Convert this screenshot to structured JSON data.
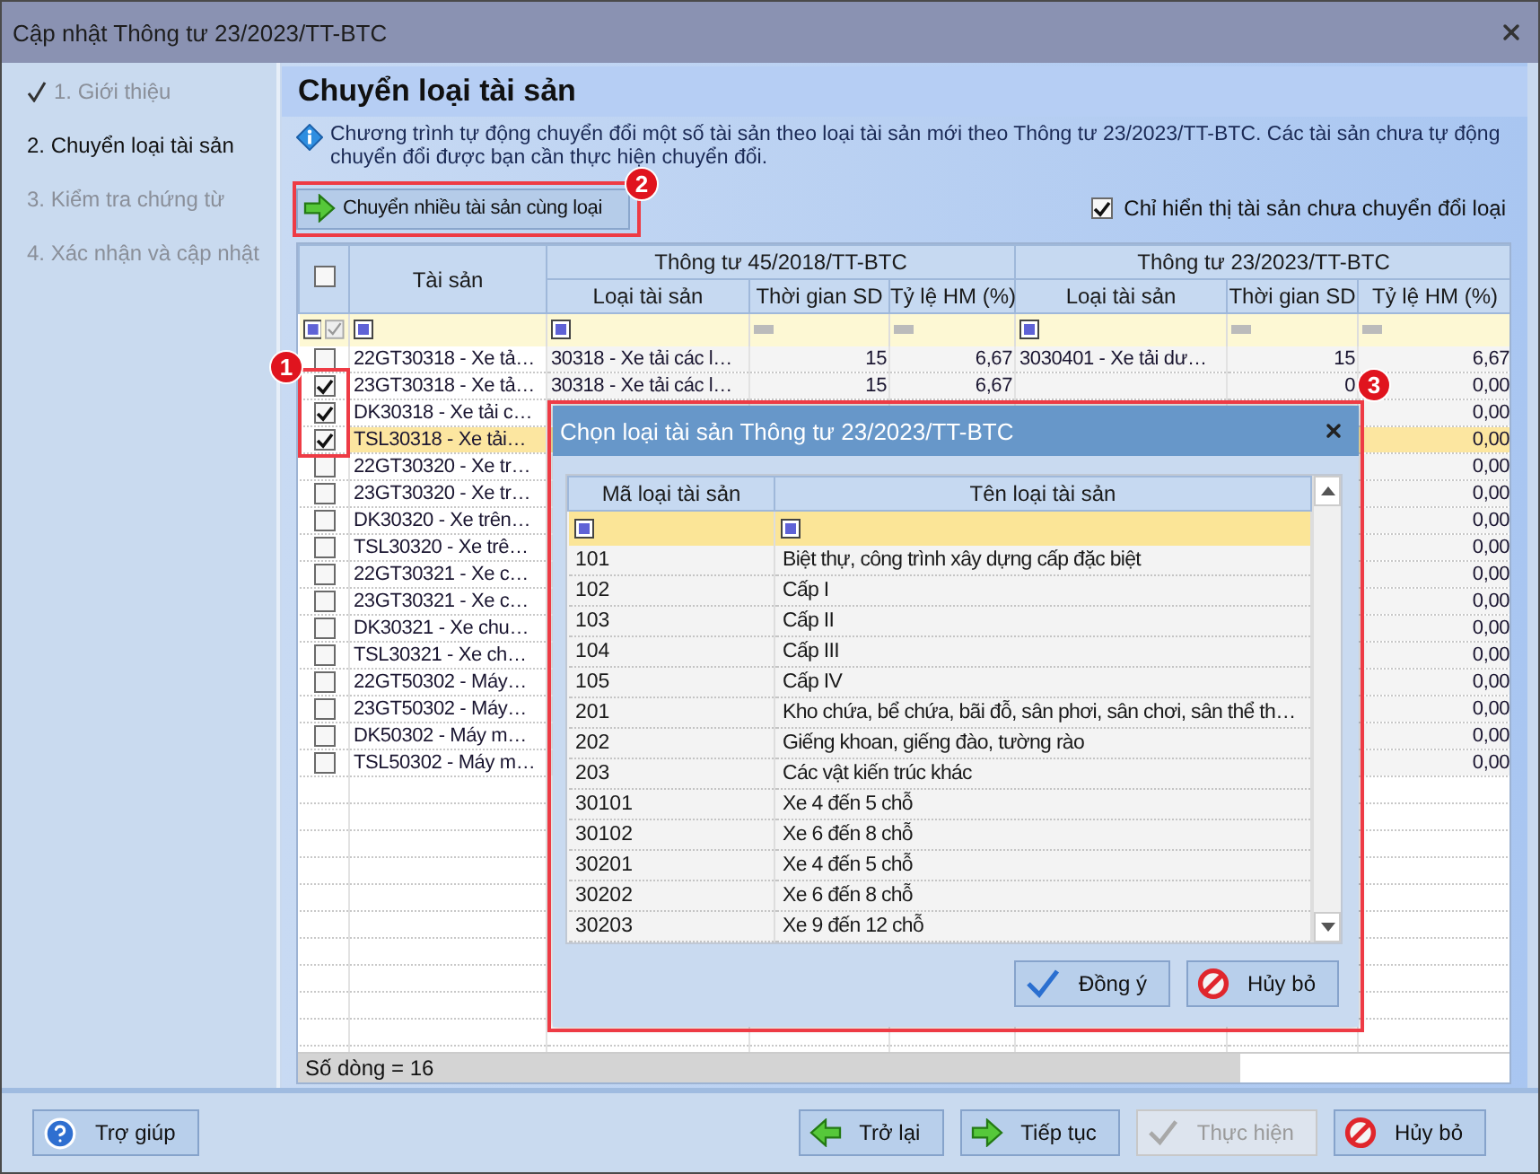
{
  "window": {
    "title": "Cập nhật Thông tư 23/2023/TT-BTC"
  },
  "steps": [
    {
      "label": "1. Giới thiệu",
      "done": true,
      "selected": false
    },
    {
      "label": "2. Chuyển loại tài sản",
      "done": false,
      "selected": true
    },
    {
      "label": "3. Kiểm tra chứng từ",
      "done": false,
      "selected": false
    },
    {
      "label": "4. Xác nhận và cập nhật",
      "done": false,
      "selected": false
    }
  ],
  "page": {
    "heading": "Chuyển loại tài sản",
    "info": "Chương trình tự động chuyển đổi một số tài sản theo loại tài sản mới theo Thông tư 23/2023/TT-BTC. Các tài sản chưa tự động chuyển đổi được bạn cần thực hiện chuyển đổi."
  },
  "convert_button": {
    "label": "Chuyển nhiều tài sản cùng loại"
  },
  "filter_toggle": {
    "label": "Chỉ hiển thị tài sản chưa chuyển đổi loại",
    "checked": true
  },
  "table": {
    "select_all": {
      "checked": false
    },
    "asset_column": {
      "label": "Tài sản"
    },
    "groups": [
      {
        "label": "Thông tư 45/2018/TT-BTC",
        "columns": [
          {
            "label": "Loại tài sản",
            "kind": "text"
          },
          {
            "label": "Thời gian SD",
            "kind": "number"
          },
          {
            "label": "Tỷ lệ HM (%)",
            "kind": "number"
          }
        ]
      },
      {
        "label": "Thông tư 23/2023/TT-BTC",
        "columns": [
          {
            "label": "Loại tài sản",
            "kind": "text"
          },
          {
            "label": "Thời gian SD",
            "kind": "number"
          },
          {
            "label": "Tỷ lệ HM (%)",
            "kind": "number"
          }
        ]
      }
    ],
    "rows": [
      {
        "checked": false,
        "selected": false,
        "cells": [
          "22GT30318 - Xe tả…",
          "30318 - Xe tải các l…",
          "15",
          "6,67",
          "3030401 - Xe tải dư…",
          "15",
          "6,67"
        ]
      },
      {
        "checked": true,
        "selected": false,
        "cells": [
          "23GT30318 - Xe tả…",
          "30318 - Xe tải các l…",
          "15",
          "6,67",
          null,
          "0",
          "0,00"
        ]
      },
      {
        "checked": true,
        "selected": false,
        "cells": [
          "DK30318 - Xe tải c…",
          null,
          null,
          null,
          null,
          null,
          "0,00"
        ]
      },
      {
        "checked": true,
        "selected": true,
        "cells": [
          "TSL30318 - Xe tải…",
          null,
          null,
          null,
          null,
          null,
          "0,00"
        ]
      },
      {
        "checked": false,
        "selected": false,
        "cells": [
          "22GT30320 - Xe tr…",
          null,
          null,
          null,
          null,
          null,
          "0,00"
        ]
      },
      {
        "checked": false,
        "selected": false,
        "cells": [
          "23GT30320 - Xe tr…",
          null,
          null,
          null,
          null,
          null,
          "0,00"
        ]
      },
      {
        "checked": false,
        "selected": false,
        "cells": [
          "DK30320 - Xe trên…",
          null,
          null,
          null,
          null,
          null,
          "0,00"
        ]
      },
      {
        "checked": false,
        "selected": false,
        "cells": [
          "TSL30320 - Xe trê…",
          null,
          null,
          null,
          null,
          null,
          "0,00"
        ]
      },
      {
        "checked": false,
        "selected": false,
        "cells": [
          "22GT30321 - Xe c…",
          null,
          null,
          null,
          null,
          null,
          "0,00"
        ]
      },
      {
        "checked": false,
        "selected": false,
        "cells": [
          "23GT30321 - Xe c…",
          null,
          null,
          null,
          null,
          null,
          "0,00"
        ]
      },
      {
        "checked": false,
        "selected": false,
        "cells": [
          "DK30321 - Xe chu…",
          null,
          null,
          null,
          null,
          null,
          "0,00"
        ]
      },
      {
        "checked": false,
        "selected": false,
        "cells": [
          "TSL30321 - Xe ch…",
          null,
          null,
          null,
          null,
          null,
          "0,00"
        ]
      },
      {
        "checked": false,
        "selected": false,
        "cells": [
          "22GT50302 - Máy…",
          null,
          null,
          null,
          null,
          null,
          "0,00"
        ]
      },
      {
        "checked": false,
        "selected": false,
        "cells": [
          "23GT50302 - Máy…",
          null,
          null,
          null,
          null,
          null,
          "0,00"
        ]
      },
      {
        "checked": false,
        "selected": false,
        "cells": [
          "DK50302 - Máy m…",
          null,
          null,
          null,
          null,
          null,
          "0,00"
        ]
      },
      {
        "checked": false,
        "selected": false,
        "cells": [
          "TSL50302 - Máy m…",
          null,
          null,
          null,
          null,
          null,
          "0,00"
        ]
      }
    ],
    "status": "Số dòng = 16"
  },
  "dialog": {
    "title": "Chọn loại tài sản Thông tư 23/2023/TT-BTC",
    "columns": [
      "Mã loại tài sản",
      "Tên loại tài sản"
    ],
    "rows": [
      {
        "code": "101",
        "name": "Biệt thự, công trình xây dựng cấp đặc biệt"
      },
      {
        "code": "102",
        "name": "Cấp I"
      },
      {
        "code": "103",
        "name": "Cấp II"
      },
      {
        "code": "104",
        "name": "Cấp III"
      },
      {
        "code": "105",
        "name": "Cấp IV"
      },
      {
        "code": "201",
        "name": "Kho chứa, bể chứa, bãi đỗ, sân phơi, sân chơi, sân thể th…"
      },
      {
        "code": "202",
        "name": "Giếng khoan, giếng đào, tường rào"
      },
      {
        "code": "203",
        "name": "Các vật kiến trúc khác"
      },
      {
        "code": "30101",
        "name": "Xe 4 đến 5 chỗ"
      },
      {
        "code": "30102",
        "name": "Xe 6 đến 8 chỗ"
      },
      {
        "code": "30201",
        "name": "Xe 4 đến 5 chỗ"
      },
      {
        "code": "30202",
        "name": "Xe 6 đến 8 chỗ"
      },
      {
        "code": "30203",
        "name": "Xe 9 đến 12 chỗ"
      }
    ],
    "buttons": [
      {
        "label": "Đồng ý",
        "kind": "confirm"
      },
      {
        "label": "Hủy bỏ",
        "kind": "cancel"
      }
    ]
  },
  "footer": {
    "buttons": [
      {
        "label": "Trợ giúp",
        "kind": "help",
        "disabled": false
      },
      {
        "label": "Trở lại",
        "kind": "back",
        "disabled": false
      },
      {
        "label": "Tiếp tục",
        "kind": "next",
        "disabled": false
      },
      {
        "label": "Thực hiện",
        "kind": "execute",
        "disabled": true
      },
      {
        "label": "Hủy bỏ",
        "kind": "cancel",
        "disabled": false
      }
    ]
  },
  "annotations": [
    {
      "label": "1"
    },
    {
      "label": "2"
    },
    {
      "label": "3"
    }
  ]
}
